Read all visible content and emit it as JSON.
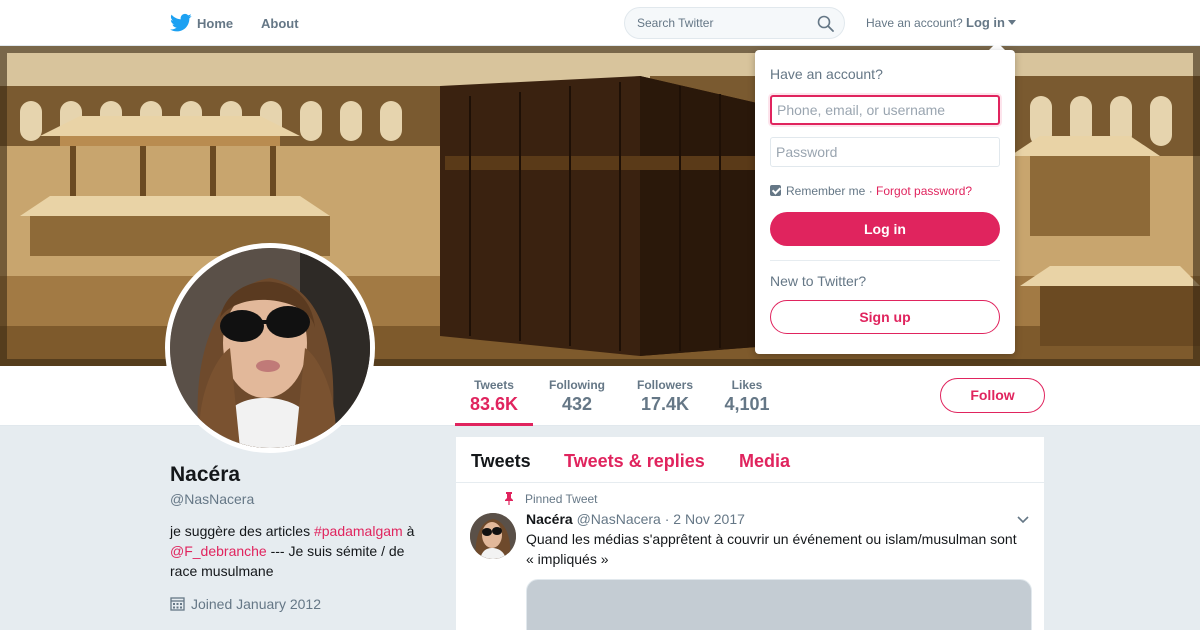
{
  "colors": {
    "accent": "#e0245e",
    "brand": "#1da1f2",
    "muted": "#657786",
    "background": "#e6ecf0"
  },
  "topnav": {
    "home_label": "Home",
    "about_label": "About",
    "search_placeholder": "Search Twitter",
    "have_account_label": "Have an account?",
    "login_label": "Log in",
    "icons": {
      "logo": "twitter-bird-icon",
      "search": "search-icon",
      "caret": "caret-down-icon"
    }
  },
  "profile": {
    "name": "Nacéra",
    "handle": "@NasNacera",
    "bio_part1": "je suggère des articles ",
    "bio_hashtag": "#padamalgam",
    "bio_part2": " à ",
    "bio_mention": "@F_debranche",
    "bio_part3": " --- Je suis sémite / de race musulmane",
    "joined": "Joined January 2012"
  },
  "stats": [
    {
      "label": "Tweets",
      "value": "83.6K"
    },
    {
      "label": "Following",
      "value": "432"
    },
    {
      "label": "Followers",
      "value": "17.4K"
    },
    {
      "label": "Likes",
      "value": "4,101"
    }
  ],
  "follow_label": "Follow",
  "timeline": {
    "tabs": [
      "Tweets",
      "Tweets & replies",
      "Media"
    ],
    "pinned_label": "Pinned Tweet",
    "tweet": {
      "name": "Nacéra",
      "handle": "@NasNacera",
      "date": "2 Nov 2017",
      "text": "Quand les médias s'apprêtent à couvrir un événement ou islam/musulman sont « impliqués »"
    }
  },
  "login_dropdown": {
    "title": "Have an account?",
    "username_placeholder": "Phone, email, or username",
    "password_placeholder": "Password",
    "remember_label": "Remember me",
    "separator": " · ",
    "forgot_label": "Forgot password?",
    "login_button": "Log in",
    "new_label": "New to Twitter?",
    "signup_button": "Sign up"
  }
}
